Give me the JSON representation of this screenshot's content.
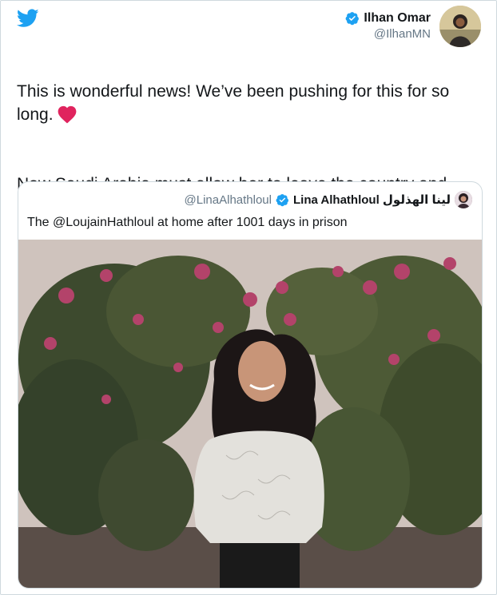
{
  "tweet": {
    "author_name": "Ilhan Omar",
    "author_handle": "@IlhanMN",
    "text": "This is wonderful news! We’ve been pushing for this for so long.",
    "text_2": "Now Saudi Arabia must allow her to leave the country and release the rest of the women's rights activists still in prison."
  },
  "quoted": {
    "handle": "@LinaAlhathloul",
    "name": "Lina Alhathloul لينا الهذلول",
    "text": "The @LoujainHathloul at home after 1001 days in prison"
  },
  "icons": {
    "logo": "twitter-bird-icon",
    "verified": "verified-badge-icon",
    "emoji": "red-heart-icon"
  },
  "colors": {
    "brand": "#1da1f2",
    "text": "#14171a",
    "muted": "#657786",
    "heart": "#e0245e",
    "border": "#cfd9de"
  }
}
